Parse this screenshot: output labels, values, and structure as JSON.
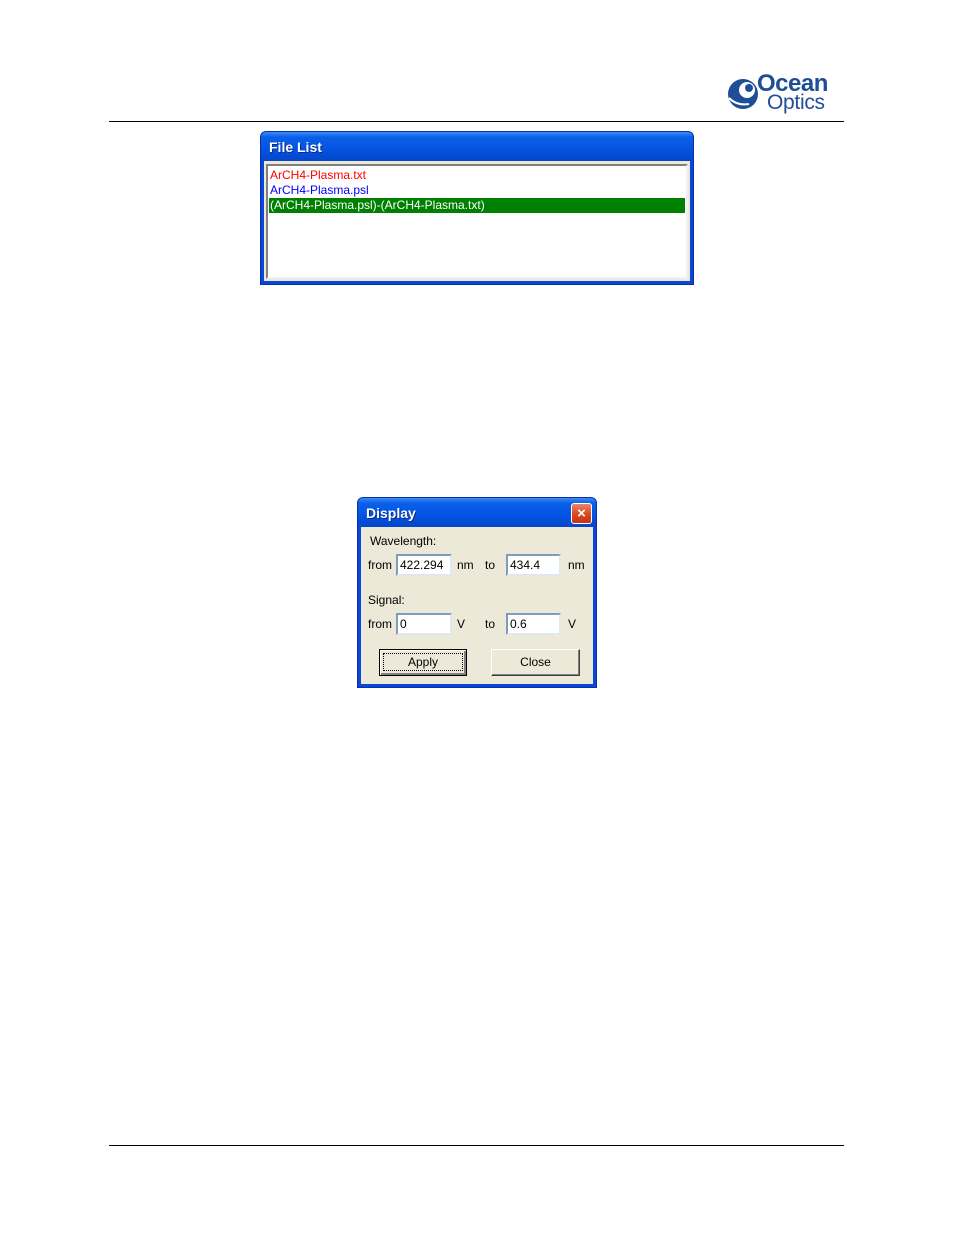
{
  "logo": {
    "line1": "Ocean",
    "line2": "Optics"
  },
  "file_list": {
    "title": "File List",
    "items": [
      {
        "label": "ArCH4-Plasma.txt",
        "color": "#ff0000",
        "selected": false
      },
      {
        "label": "ArCH4-Plasma.psl",
        "color": "#0000ff",
        "selected": false
      },
      {
        "label": "(ArCH4-Plasma.psl)-(ArCH4-Plasma.txt)",
        "color": "#ffffff",
        "selected": true
      }
    ]
  },
  "display": {
    "title": "Display",
    "close_icon": "×",
    "wavelength": {
      "label": "Wavelength:",
      "from_label": "from",
      "from_value": "422.294",
      "unit": "nm",
      "to_label": "to",
      "to_value": "434.4"
    },
    "signal": {
      "label": "Signal:",
      "from_label": "from",
      "from_value": "0",
      "unit": "V",
      "to_label": "to",
      "to_value": "0.6"
    },
    "apply_label": "Apply",
    "close_label": "Close"
  },
  "colors": {
    "title_bar": "#0553e2",
    "selected_row": "#008000"
  }
}
